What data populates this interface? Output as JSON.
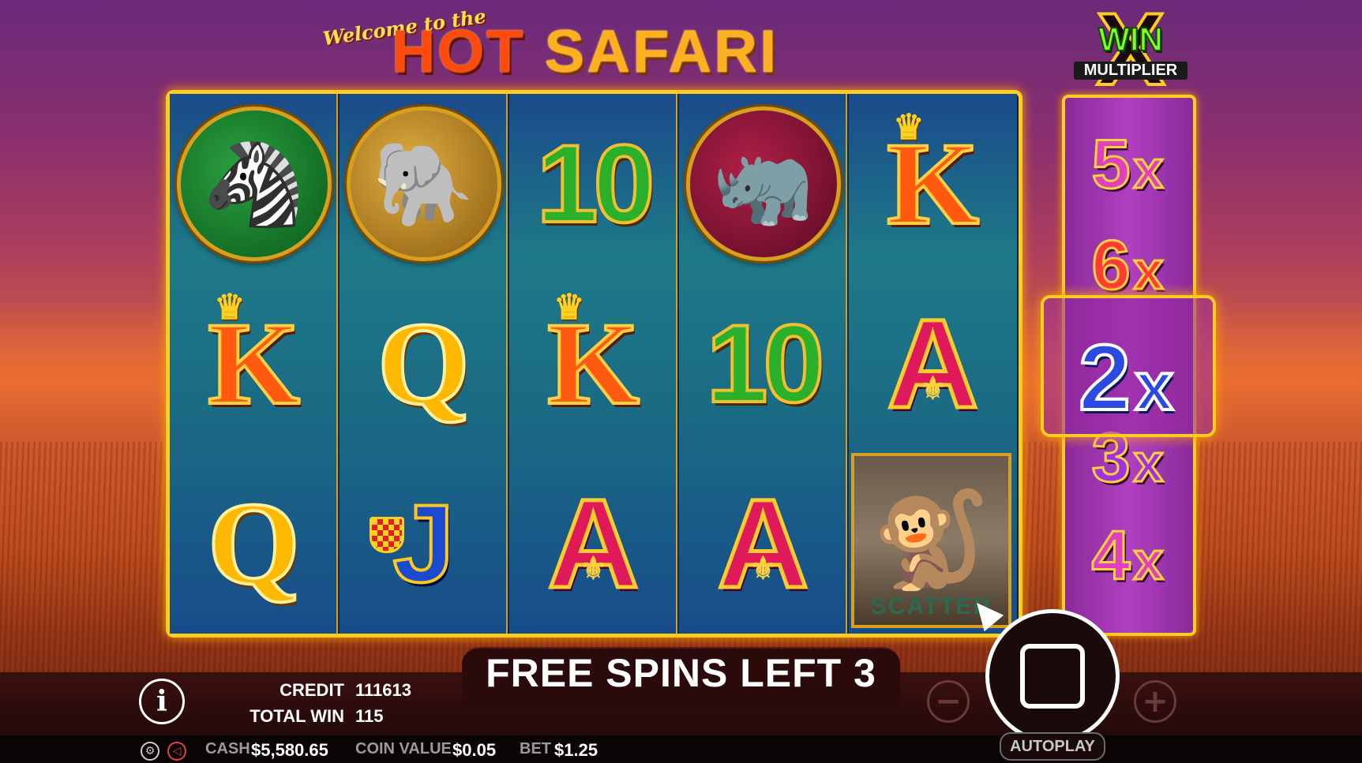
{
  "game": {
    "logo_welcome": "Welcome to the",
    "logo_hot": "HOT",
    "logo_safari": "SAFARI"
  },
  "reels": [
    [
      {
        "type": "animal",
        "name": "zebra",
        "glyph": "🦓",
        "bg": "green"
      },
      {
        "type": "card",
        "label": "K"
      },
      {
        "type": "card",
        "label": "Q"
      }
    ],
    [
      {
        "type": "animal",
        "name": "elephant",
        "glyph": "🐘",
        "bg": "gold"
      },
      {
        "type": "card",
        "label": "Q"
      },
      {
        "type": "card",
        "label": "J"
      }
    ],
    [
      {
        "type": "card",
        "label": "10"
      },
      {
        "type": "card",
        "label": "K"
      },
      {
        "type": "card",
        "label": "A"
      }
    ],
    [
      {
        "type": "animal",
        "name": "rhino",
        "glyph": "🦏",
        "bg": "maroon"
      },
      {
        "type": "card",
        "label": "10"
      },
      {
        "type": "card",
        "label": "A"
      }
    ],
    [
      {
        "type": "card",
        "label": "K"
      },
      {
        "type": "card",
        "label": "A"
      },
      {
        "type": "scatter",
        "name": "mandrill",
        "glyph": "🐒",
        "label": "SCATTER"
      }
    ]
  ],
  "multiplier": {
    "title_win": "WIN",
    "title_label": "MULTIPLIER",
    "title_x": "X",
    "items": [
      {
        "value": "5",
        "suffix": "x",
        "color": "#e040c0"
      },
      {
        "value": "6",
        "suffix": "x",
        "color": "#ff3a3a"
      },
      {
        "value": "2",
        "suffix": "x",
        "color": "#2a4ae0",
        "active": true
      },
      {
        "value": "3",
        "suffix": "x",
        "color": "#a030e0"
      },
      {
        "value": "4",
        "suffix": "x",
        "color": "#e040c0"
      }
    ]
  },
  "status": {
    "free_spins_text": "FREE SPINS LEFT 3",
    "credit_label": "CREDIT",
    "credit_value": "111613",
    "total_win_label": "TOTAL WIN",
    "total_win_value": "115"
  },
  "footer": {
    "cash_label": "CASH",
    "cash_value": "$5,580.65",
    "coin_value_label": "COIN VALUE",
    "coin_value": "$0.05",
    "bet_label": "BET",
    "bet_value": "$1.25",
    "autoplay_label": "AUTOPLAY"
  },
  "controls": {
    "info_icon": "i",
    "minus_icon": "−",
    "plus_icon": "+",
    "settings_icon": "gear-icon",
    "sound_icon": "speaker-icon"
  }
}
